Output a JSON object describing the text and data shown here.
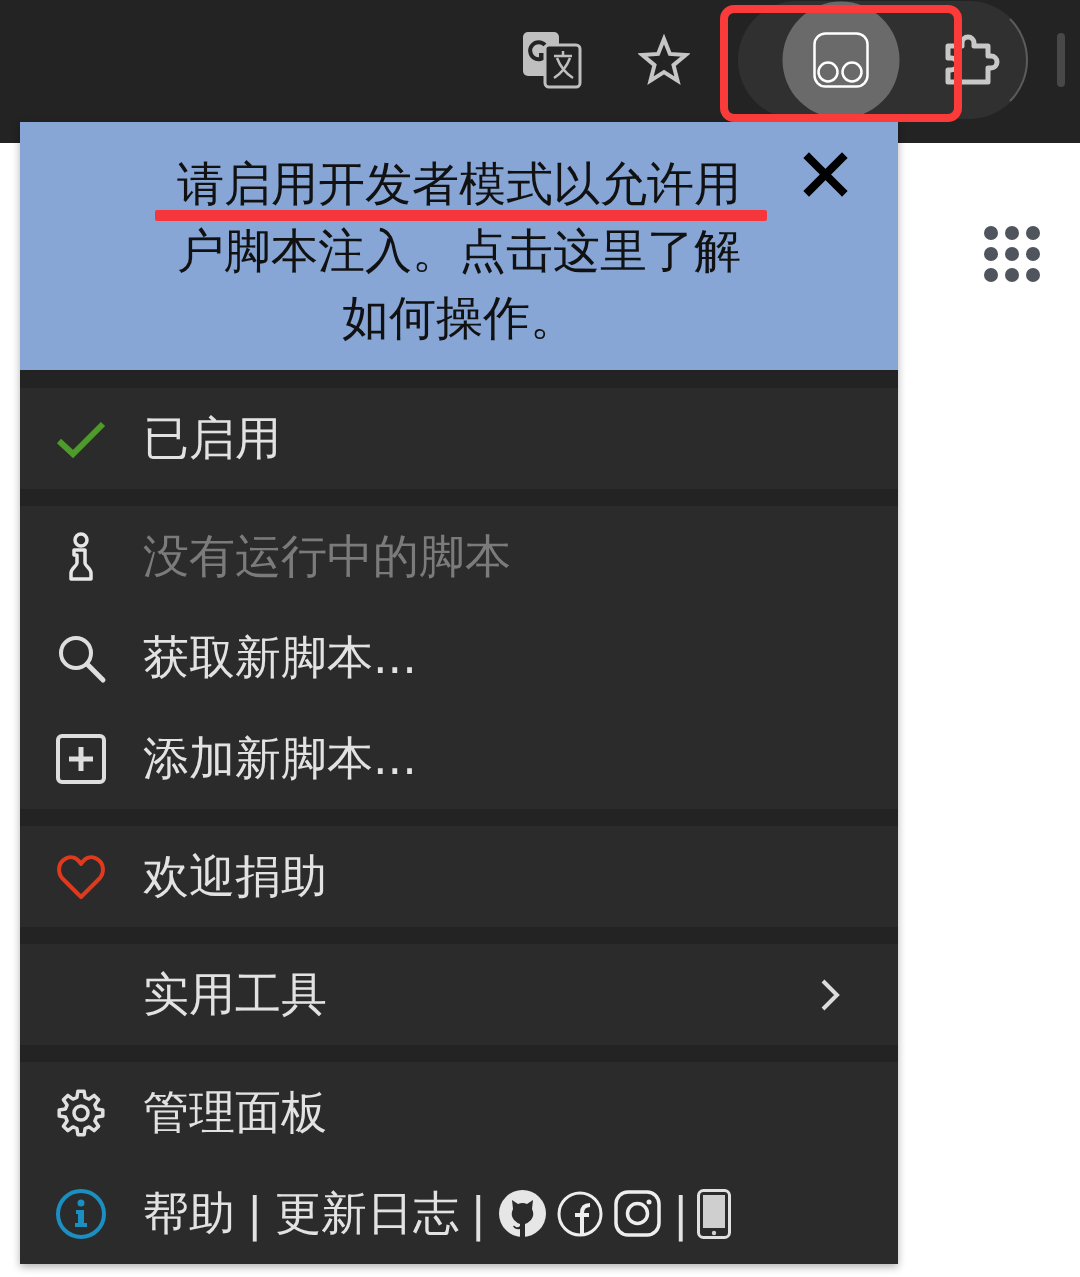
{
  "toolbar": {
    "buttons": [
      {
        "pressed": false
      },
      {
        "pressed": false
      },
      {
        "pressed": true
      },
      {
        "pressed": false
      }
    ]
  },
  "popup": {
    "notice": {
      "text": "请启用开发者模式以允许用户脚本注入。点击这里了解如何操作。"
    },
    "sections": [
      {
        "items": [
          {
            "kind": "toggle",
            "label": "已启用",
            "checked": true,
            "disabled": false
          }
        ]
      },
      {
        "items": [
          {
            "kind": "status",
            "label": "没有运行中的脚本",
            "disabled": true
          },
          {
            "kind": "search",
            "label": "获取新脚本...",
            "disabled": false
          },
          {
            "kind": "add",
            "label": "添加新脚本...",
            "disabled": false
          }
        ]
      },
      {
        "items": [
          {
            "kind": "donate",
            "label": "欢迎捐助",
            "disabled": false
          }
        ]
      },
      {
        "items": [
          {
            "kind": "submenu",
            "label": "实用工具",
            "disabled": false
          }
        ]
      },
      {
        "items": [
          {
            "kind": "dashboard",
            "label": "管理面板",
            "disabled": false
          },
          {
            "kind": "help",
            "links": [
              "帮助",
              "更新日志"
            ],
            "separators": [
              "|",
              "|",
              "|"
            ],
            "disabled": false
          }
        ]
      }
    ]
  },
  "annotations": {
    "frame": true,
    "underline": true
  }
}
